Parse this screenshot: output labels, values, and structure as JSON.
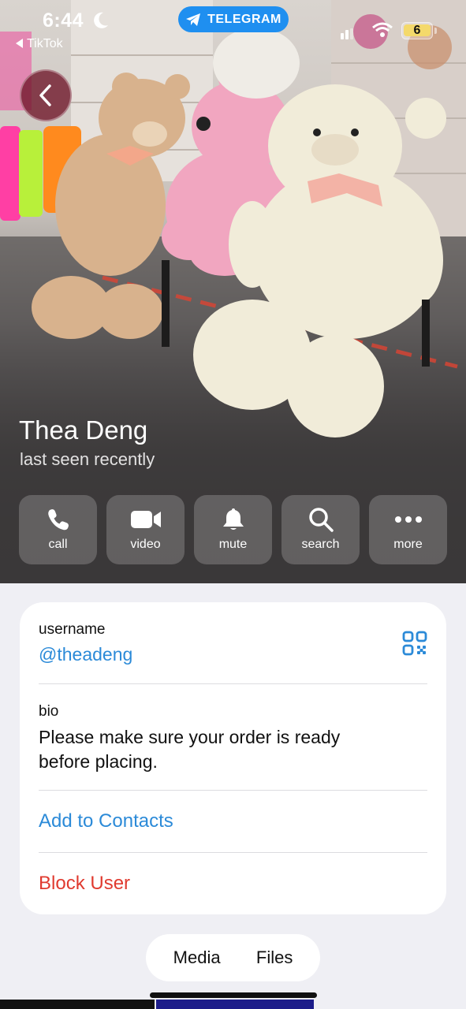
{
  "status_bar": {
    "time": "6:44",
    "back_app": "TikTok",
    "pill_label": "TELEGRAM",
    "battery_level": "6"
  },
  "profile": {
    "name": "Thea Deng",
    "status": "last seen recently"
  },
  "actions": [
    {
      "label": "call",
      "icon": "phone-icon"
    },
    {
      "label": "video",
      "icon": "video-camera-icon"
    },
    {
      "label": "mute",
      "icon": "bell-icon"
    },
    {
      "label": "search",
      "icon": "magnifier-icon"
    },
    {
      "label": "more",
      "icon": "ellipsis-icon"
    }
  ],
  "info": {
    "username_label": "username",
    "username_value": "@theadeng",
    "bio_label": "bio",
    "bio_value": "Please make sure your order is ready before placing.",
    "add_contacts": "Add to Contacts",
    "block_user": "Block User"
  },
  "tabs": [
    {
      "label": "Media"
    },
    {
      "label": "Files"
    }
  ],
  "colors": {
    "accent_blue": "#2b8ad8",
    "danger_red": "#e03a2f",
    "telegram_blue": "#1f8ff0",
    "battery_yellow": "#f4d96b"
  }
}
